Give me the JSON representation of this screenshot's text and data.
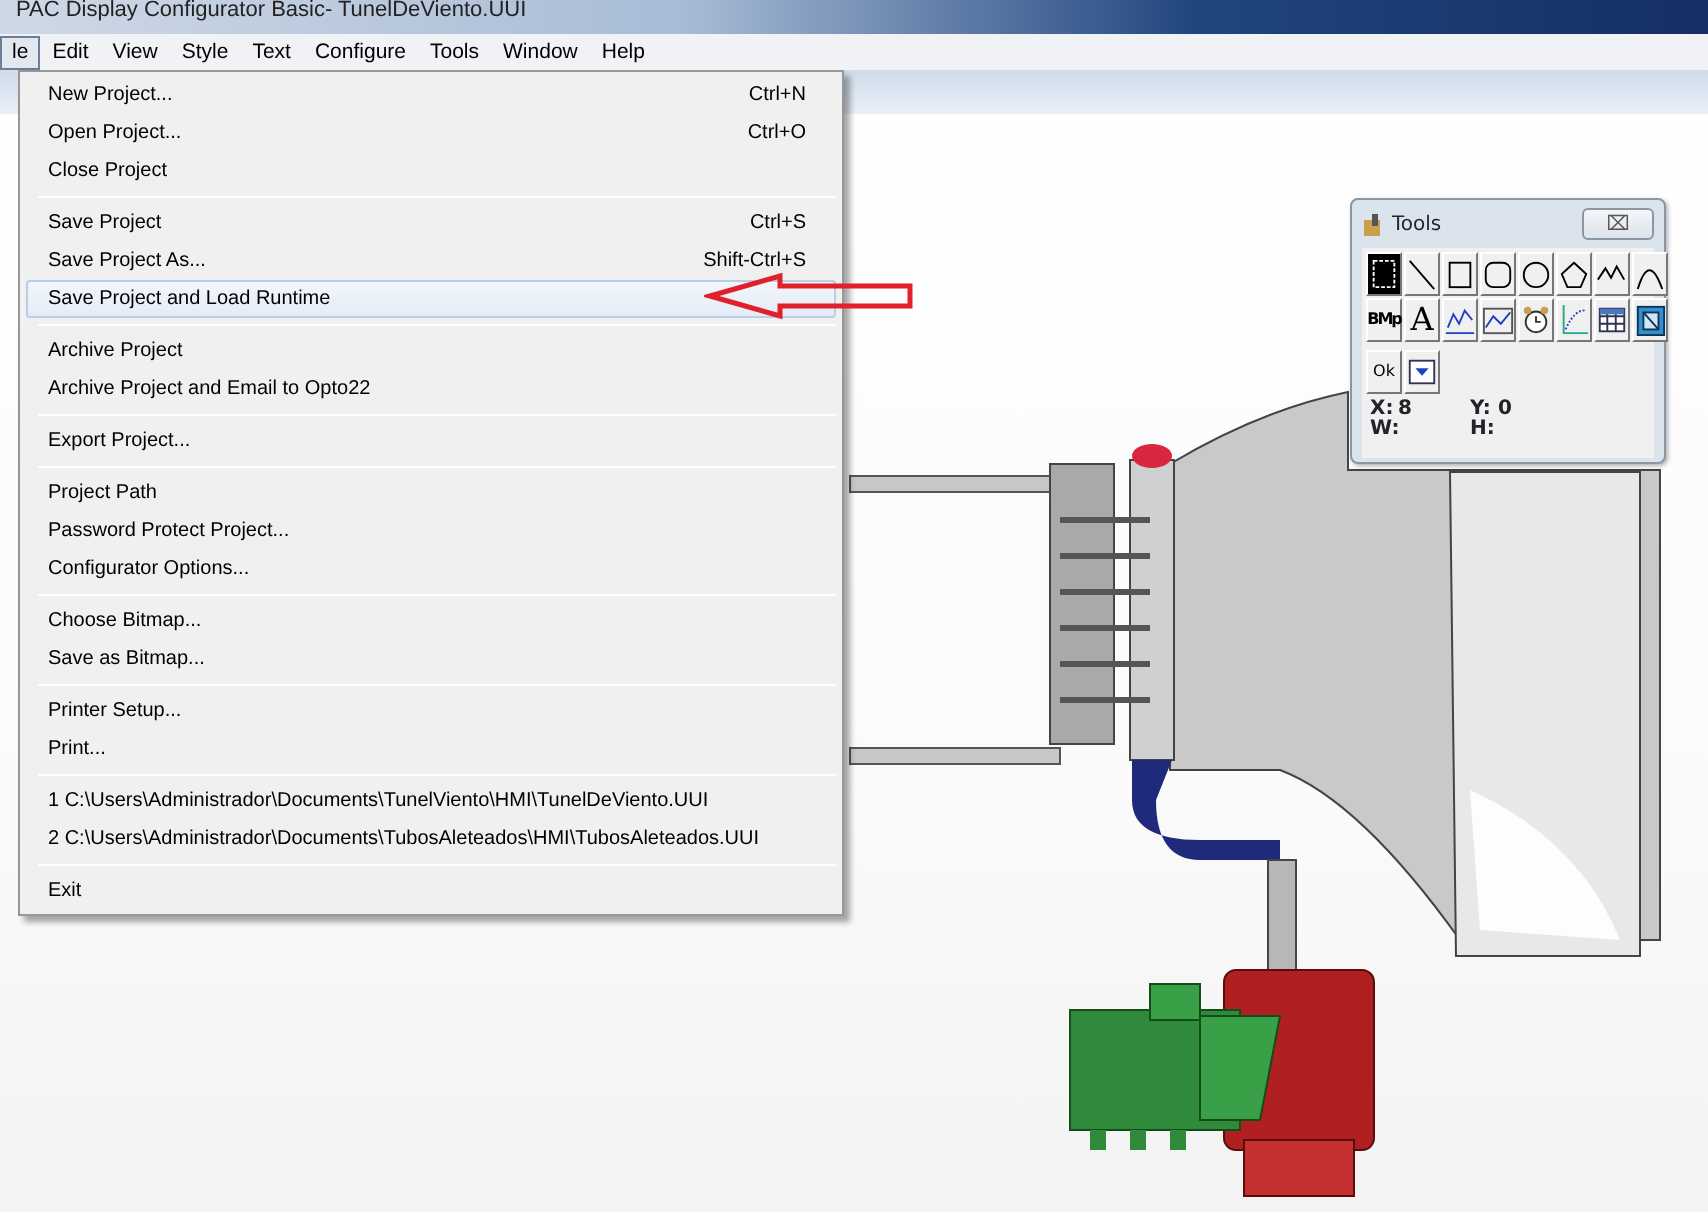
{
  "window": {
    "title": "PAC Display Configurator Basic- TunelDeViento.UUI"
  },
  "menu_bar": [
    {
      "label": "le",
      "selected": true
    },
    {
      "label": "Edit",
      "selected": false
    },
    {
      "label": "View",
      "selected": false
    },
    {
      "label": "Style",
      "selected": false
    },
    {
      "label": "Text",
      "selected": false
    },
    {
      "label": "Configure",
      "selected": false
    },
    {
      "label": "Tools",
      "selected": false
    },
    {
      "label": "Window",
      "selected": false
    },
    {
      "label": "Help",
      "selected": false
    }
  ],
  "file_menu": {
    "groups": [
      [
        {
          "label": "New Project...",
          "shortcut": "Ctrl+N",
          "selected": false
        },
        {
          "label": "Open Project...",
          "shortcut": "Ctrl+O",
          "selected": false
        },
        {
          "label": "Close Project",
          "selected": false
        }
      ],
      [
        {
          "label": "Save Project",
          "shortcut": "Ctrl+S",
          "selected": false
        },
        {
          "label": "Save Project As...",
          "shortcut": "Shift-Ctrl+S",
          "selected": false
        },
        {
          "label": "Save Project and Load Runtime",
          "selected": true
        }
      ],
      [
        {
          "label": "Archive Project",
          "selected": false
        },
        {
          "label": "Archive Project and Email to Opto22",
          "selected": false
        }
      ],
      [
        {
          "label": "Export Project...",
          "selected": false
        }
      ],
      [
        {
          "label": "Project Path",
          "selected": false
        },
        {
          "label": "Password Protect Project...",
          "selected": false
        },
        {
          "label": "Configurator Options...",
          "selected": false
        }
      ],
      [
        {
          "label": "Choose Bitmap...",
          "selected": false
        },
        {
          "label": "Save as Bitmap...",
          "selected": false
        }
      ],
      [
        {
          "label": "Printer Setup...",
          "selected": false
        },
        {
          "label": "Print...",
          "selected": false
        }
      ],
      [
        {
          "label": "1 C:\\Users\\Administrador\\Documents\\TunelViento\\HMI\\TunelDeViento.UUI",
          "selected": false
        },
        {
          "label": "2 C:\\Users\\Administrador\\Documents\\TubosAleteados\\HMI\\TubosAleteados.UUI",
          "selected": false
        }
      ],
      [
        {
          "label": "Exit",
          "selected": false
        }
      ]
    ]
  },
  "tools_palette": {
    "title": "Tools",
    "close": "⌧",
    "tools": [
      {
        "kind": "select",
        "selected": true
      },
      {
        "kind": "line",
        "selected": false
      },
      {
        "kind": "rectangle",
        "selected": false
      },
      {
        "kind": "rounded",
        "selected": false
      },
      {
        "kind": "ellipse",
        "selected": false
      },
      {
        "kind": "polygon",
        "selected": false
      },
      {
        "kind": "polyline",
        "selected": false
      },
      {
        "kind": "arc",
        "selected": false
      },
      {
        "kind": "bitmap",
        "label": "BMp",
        "selected": false
      },
      {
        "kind": "text",
        "label": "A",
        "selected": false
      },
      {
        "kind": "trend",
        "selected": false
      },
      {
        "kind": "histogram",
        "selected": false
      },
      {
        "kind": "alarm",
        "selected": false
      },
      {
        "kind": "xy",
        "selected": false
      },
      {
        "kind": "table",
        "selected": false
      },
      {
        "kind": "frame",
        "selected": false
      },
      {
        "kind": "button",
        "label": "Ok",
        "selected": false
      },
      {
        "kind": "dropdown",
        "selected": false
      }
    ],
    "coords": [
      {
        "label": "X:",
        "value": "8"
      },
      {
        "label": "Y:",
        "value": "0"
      },
      {
        "label": "W:"
      },
      {
        "label": "H:"
      }
    ]
  }
}
